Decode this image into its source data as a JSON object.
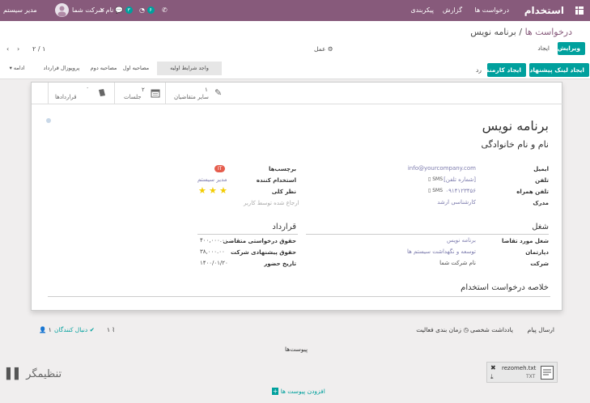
{
  "navbar": {
    "brand": "استخدام",
    "menus": [
      "درخواست ها",
      "گزارش",
      "پیکربندی"
    ],
    "user_name": "مدیر سیستم",
    "company": "نام شرکت شما",
    "badge_chat": "۳",
    "badge_activity": "۶"
  },
  "breadcrumb": {
    "parent": "درخواست ها",
    "separator": "/",
    "current": "برنامه نویس"
  },
  "toolbar": {
    "edit": "ویرایش",
    "create": "ایجاد",
    "action": "عمل",
    "pager": "۱ / ۲"
  },
  "header_buttons": {
    "create_offer_link": "ایجاد لینک پیشنهاد",
    "create_employee": "ایجاد کارمند",
    "refuse": "رد"
  },
  "stages": [
    "واجد شرایط اولیه",
    "مصاحبه اول",
    "مصاحبه دوم",
    "پروپوزال قرارداد",
    "ادامه"
  ],
  "smart_buttons": {
    "other_applicants_count": "۱",
    "other_applicants_label": "سایر متقاضیان",
    "meetings_count": "۲",
    "meetings_label": "جلسات",
    "contracts_label": "قراردادها"
  },
  "applicant": {
    "title": "برنامه نویس",
    "name_placeholder": "نام و نام خانوادگی",
    "email_label": "ایمیل",
    "email": "info@yourcompany.com",
    "phone_label": "تلفن",
    "phone_placeholder": "[شماره تلفن]",
    "mobile_label": "تلفن همراه",
    "mobile": "۰۹۱۴۱۲۳۴۵۶",
    "sms": "SMS",
    "degree_label": "مدرک",
    "degree": "کارشناسی ارشد",
    "tags_label": "برچسب‌ها",
    "tag_value": "IT",
    "recruiter_label": "استخدام کننده",
    "recruiter": "مدیر سیستم",
    "evaluation_label": "نظر کلی",
    "evaluation_stars": 3,
    "referred_placeholder": "ارجاع شده توسط کاربر"
  },
  "job": {
    "section": "شغل",
    "applied_job_label": "شغل مورد تقاضا",
    "applied_job": "برنامه نویس",
    "department_label": "دپارتمان",
    "department": "توسعه و نگهداشت سیستم ها",
    "company_label": "شرکت",
    "company": "نام شرکت شما"
  },
  "contract": {
    "section": "قرارداد",
    "expected_salary_label": "حقوق درخواستی متقاضی",
    "expected_salary": "۴۰۰,۰۰۰.۰۰",
    "proposed_salary_label": "حقوق پیشنهادی شرکت",
    "proposed_salary": "۳۸,۰۰۰.۰۰",
    "availability_label": "تاریخ حضور",
    "availability": "۱۴۰۰/۰۱/۲۰"
  },
  "summary": {
    "section": "خلاصه درخواست استخدام"
  },
  "chatter": {
    "send_message": "ارسال پیام",
    "log_note": "یادداشت شخصی",
    "schedule_activity": "زمان بندی فعالیت",
    "attachments_count": "۱",
    "follow": "دنبال کنندگان",
    "followers_count": "۱",
    "attachments_title": "پیوست‌ها",
    "file_name": "rezomeh.txt",
    "file_ext": "TXT",
    "add_attachments": "افزودن پیوست ها"
  },
  "watermark": "تنظیمگر",
  "colors": {
    "navbar": "#875a7b",
    "primary": "#00a09d",
    "link": "#7c7bad",
    "tag": "#e55d4d",
    "star": "#f3cc00"
  }
}
